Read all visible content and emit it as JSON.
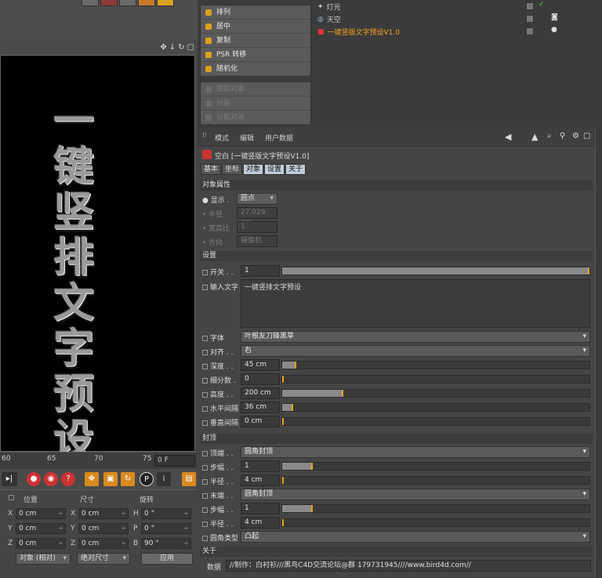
{
  "viewport": {
    "text_chars": [
      "一",
      "键",
      "竖",
      "排",
      "文",
      "字",
      "预",
      "设"
    ]
  },
  "timeline": {
    "ticks": [
      "60",
      "65",
      "70",
      "75"
    ],
    "frame": "0 F"
  },
  "coords": {
    "headers": {
      "position": "位置",
      "size": "尺寸",
      "rotation": "旋转"
    },
    "rows": [
      {
        "a": "X",
        "pos": "0 cm",
        "b": "X",
        "size": "0 cm",
        "c": "H",
        "rot": "0 °"
      },
      {
        "a": "Y",
        "pos": "0 cm",
        "b": "Y",
        "size": "0 cm",
        "c": "P",
        "rot": "0 °"
      },
      {
        "a": "Z",
        "pos": "0 cm",
        "b": "Z",
        "size": "0 cm",
        "c": "B",
        "rot": "90 °"
      }
    ],
    "mode_select": "对象 (相对)",
    "size_select": "绝对尺寸",
    "apply": "应用"
  },
  "context_menu": {
    "items": [
      "排列",
      "居中",
      "复制",
      "PSR 转移",
      "随机化"
    ],
    "disabled": [
      "跟踪对象",
      "分裂",
      "分割对话"
    ]
  },
  "objects": {
    "rows": [
      "灯光",
      "天空",
      "一键竖版文字预设V1.0"
    ]
  },
  "attr": {
    "menu": [
      "模式",
      "编辑",
      "用户数据"
    ],
    "title": "空白 [一键竖版文字预设V1.0]",
    "tabs": [
      "基本",
      "坐标",
      "对象",
      "设置",
      "关于"
    ],
    "sec_object": "对象属性",
    "display_label": "显示",
    "display_value": "圆点",
    "radius_label": "半径",
    "radius_value": "27.029 cm",
    "aspect_label": "宽高比",
    "aspect_value": "1",
    "orient_label": "方向",
    "orient_value": "摄像机",
    "sec_settings": "设置",
    "switch_label": "开关",
    "switch_value": "1",
    "input_label": "输入文字",
    "input_value": "一键竖排文字预设",
    "font_label": "字体",
    "font_value": "叶根友刀锋黑草",
    "align_label": "对齐",
    "align_value": "右",
    "depth_label": "深度",
    "depth_value": "45 cm",
    "subdiv_label": "细分数",
    "subdiv_value": "0",
    "height_label": "高度",
    "height_value": "200 cm",
    "hspace_label": "水平间隔",
    "hspace_value": "36 cm",
    "vspace_label": "垂直间隔",
    "vspace_value": "0 cm",
    "sec_caps": "封顶",
    "top_label": "顶端",
    "top_value": "圆角封顶",
    "step1_label": "步幅",
    "step1_value": "1",
    "rad1_label": "半径",
    "rad1_value": "4 cm",
    "end_label": "末端",
    "end_value": "圆角封顶",
    "step2_label": "步幅",
    "step2_value": "1",
    "rad2_label": "半径",
    "rad2_value": "4 cm",
    "captype_label": "圆角类型",
    "captype_value": "凸起",
    "sec_about": "关于",
    "data_label": "数据",
    "data_value": "//制作：白衬衫///黑鸟C4D交流论坛@群 179731945////www.bird4d.com//"
  },
  "slider_fill": {
    "switch": 1.0,
    "depth": 0.045,
    "subdiv": 0.0,
    "height": 0.2,
    "hspace": 0.036,
    "vspace": 0.0,
    "step1": 0.1,
    "rad1": 0.0,
    "step2": 0.1,
    "rad2": 0.0
  },
  "colors": {
    "accent": "#e6a21d",
    "highlight_object": "#f2a31d",
    "tab_active": "#c0cbd8"
  }
}
